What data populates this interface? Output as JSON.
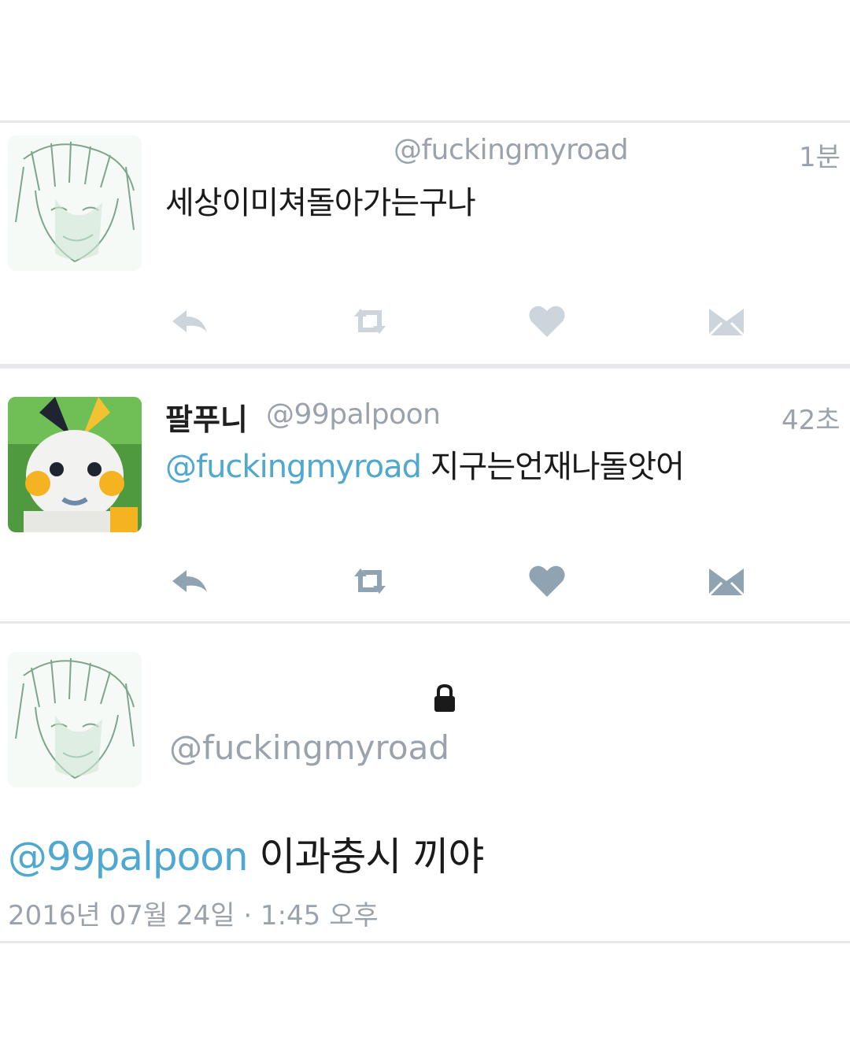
{
  "tweets": [
    {
      "handle": "@fuckingmyroad",
      "time": "1분",
      "text": "세상이미쳐돌아가는구나"
    },
    {
      "name": "팔푸니",
      "handle": "@99palpoon",
      "time": "42초",
      "mention": "@fuckingmyroad",
      "text": "지구는언재나돌앗어"
    }
  ],
  "detail": {
    "handle": "@fuckingmyroad",
    "mention": "@99palpoon",
    "text": "이과충시 끼야",
    "date": "2016년 07월 24일 · 1:45 오후"
  },
  "actions": [
    "reply-icon",
    "retweet-icon",
    "like-icon",
    "message-icon"
  ],
  "colors": {
    "mention": "#4fa8cf",
    "muted": "#9aa3ab",
    "icon": "#8fa3b3",
    "divider": "#e6e8eb"
  }
}
